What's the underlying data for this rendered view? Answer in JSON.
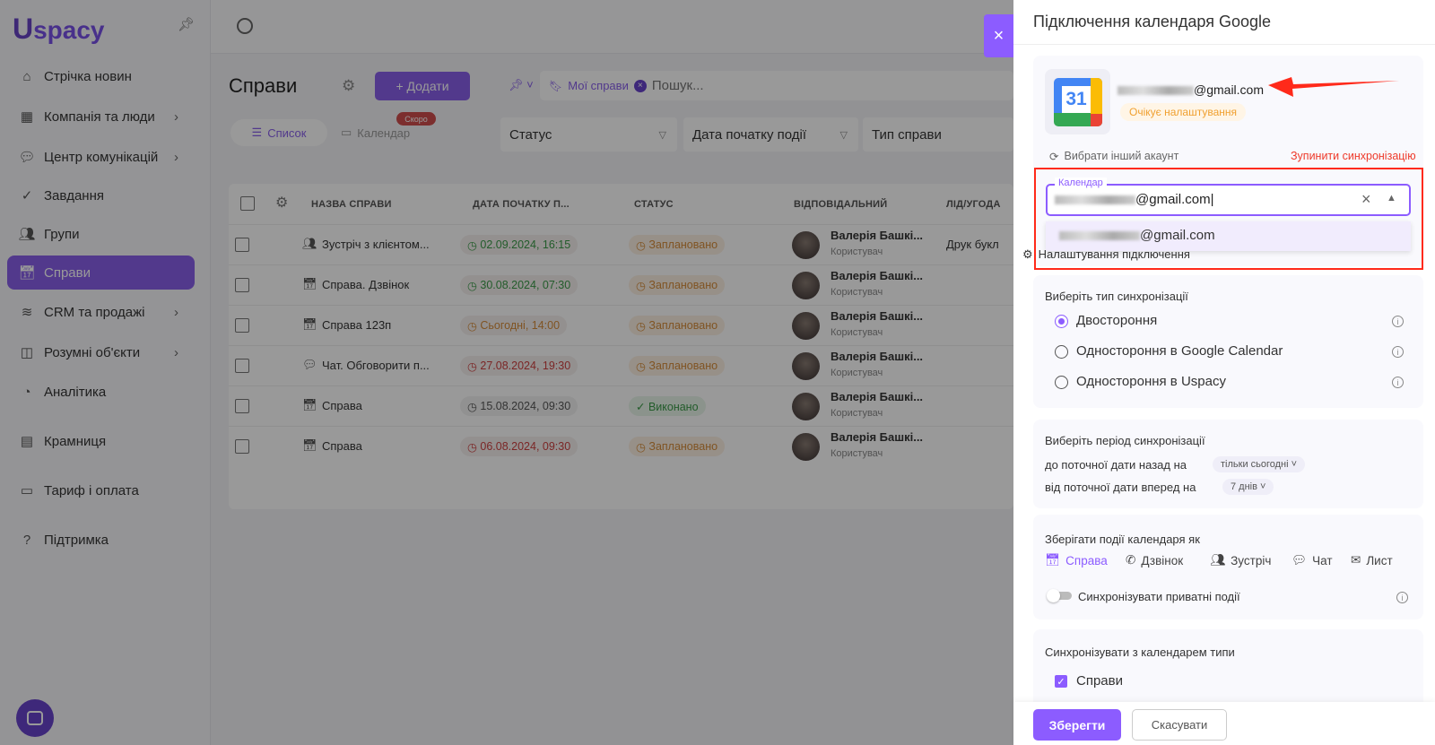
{
  "app": {
    "logo": "Uspacy"
  },
  "sidebar": {
    "items": [
      {
        "label": "Стрічка новин",
        "icon": "home-icon",
        "chevron": false
      },
      {
        "label": "Компанія та люди",
        "icon": "building-icon",
        "chevron": true
      },
      {
        "label": "Центр комунікацій",
        "icon": "chat-icon",
        "chevron": true
      },
      {
        "label": "Завдання",
        "icon": "check-circle-icon",
        "chevron": false
      },
      {
        "label": "Групи",
        "icon": "users-icon",
        "chevron": false
      },
      {
        "label": "Справи",
        "icon": "calendar-check-icon",
        "chevron": false,
        "active": true
      },
      {
        "label": "CRM та продажі",
        "icon": "database-icon",
        "chevron": true
      },
      {
        "label": "Розумні об'єкти",
        "icon": "smart-object-icon",
        "chevron": true
      },
      {
        "label": "Аналітика",
        "icon": "chart-icon",
        "chevron": false
      },
      {
        "label": "Крамниця",
        "icon": "store-icon",
        "chevron": false
      },
      {
        "label": "Тариф і оплата",
        "icon": "wallet-icon",
        "chevron": false
      },
      {
        "label": "Підтримка",
        "icon": "help-icon",
        "chevron": false
      }
    ]
  },
  "page": {
    "title": "Справи",
    "add_label": "+ Додати",
    "filter_chip": "Мої справи",
    "search_placeholder": "Пошук...",
    "tabs": [
      {
        "label": "Список",
        "active": true
      },
      {
        "label": "Календар",
        "badge": "Скоро"
      }
    ],
    "filters": [
      "Статус",
      "Дата початку події",
      "Тип справи"
    ]
  },
  "table": {
    "columns": [
      "НАЗВА СПРАВИ",
      "ДАТА ПОЧАТКУ П...",
      "СТАТУС",
      "ВІДПОВІДАЛЬНИЙ",
      "ЛІД/УГОДА"
    ],
    "rows": [
      {
        "icon": "users-icon",
        "name": "Зустріч з клієнтом...",
        "date": "02.09.2024, 16:15",
        "date_color": "#2e9e3e",
        "status": "Заплановано",
        "status_color": "#e08a2a",
        "resp": "Валерія Башкі...",
        "role": "Користувач",
        "lead": "Друк букл"
      },
      {
        "icon": "calendar-check-icon",
        "name": "Справа. Дзвінок",
        "date": "30.08.2024, 07:30",
        "date_color": "#2e9e3e",
        "status": "Заплановано",
        "status_color": "#e08a2a",
        "resp": "Валерія Башкі...",
        "role": "Користувач",
        "lead": ""
      },
      {
        "icon": "calendar-check-icon",
        "name": "Справа 123п",
        "date": "Сьогодні, 14:00",
        "date_color": "#e08a2a",
        "status": "Заплановано",
        "status_color": "#e08a2a",
        "resp": "Валерія Башкі...",
        "role": "Користувач",
        "lead": ""
      },
      {
        "icon": "chat-icon",
        "name": "Чат. Обговорити п...",
        "date": "27.08.2024, 19:30",
        "date_color": "#e03a3a",
        "status": "Заплановано",
        "status_color": "#e08a2a",
        "resp": "Валерія Башкі...",
        "role": "Користувач",
        "lead": ""
      },
      {
        "icon": "calendar-check-icon",
        "name": "Справа",
        "date": "15.08.2024, 09:30",
        "date_color": "#555555",
        "status": "✓ Виконано",
        "status_color": "#2e9e3e",
        "resp": "Валерія Башкі...",
        "role": "Користувач",
        "lead": ""
      },
      {
        "icon": "calendar-check-icon",
        "name": "Справа",
        "date": "06.08.2024, 09:30",
        "date_color": "#e03a3a",
        "status": "Заплановано",
        "status_color": "#e08a2a",
        "resp": "Валерія Башкі...",
        "role": "Користувач",
        "lead": ""
      }
    ]
  },
  "panel": {
    "title": "Підключення календаря Google",
    "close": "×",
    "account_email": "@gmail.com",
    "account_status": "Очікує налаштування",
    "change_account": "Вибрати інший акаунт",
    "stop_sync": "Зупинити синхронізацію",
    "calendar_label": "Календар",
    "calendar_value": "@gmail.com",
    "calendar_option": "@gmail.com",
    "connection_settings": "Налаштування підключення",
    "sync_type": {
      "label": "Виберіть тип синхронізації",
      "options": [
        {
          "label": "Двостороння",
          "selected": true
        },
        {
          "label": "Одностороння в Google Calendar",
          "selected": false
        },
        {
          "label": "Одностороння в Uspacy",
          "selected": false
        }
      ]
    },
    "period": {
      "label": "Виберіть період синхронізації",
      "back_label": "до поточної дати назад на",
      "back_value": "тільки сьогодні",
      "fwd_label": "від поточної дати вперед на",
      "fwd_value": "7 днів"
    },
    "save_as": {
      "label": "Зберігати події календаря як",
      "types": [
        {
          "label": "Справа",
          "icon": "calendar-check-icon",
          "selected": true
        },
        {
          "label": "Дзвінок",
          "icon": "phone-icon"
        },
        {
          "label": "Зустріч",
          "icon": "users-icon"
        },
        {
          "label": "Чат",
          "icon": "chat-icon"
        },
        {
          "label": "Лист",
          "icon": "mail-icon"
        }
      ],
      "private_label": "Синхронізувати приватні події",
      "private_on": false
    },
    "sync_types": {
      "label": "Синхронізувати з календарем типи",
      "items": [
        {
          "label": "Справи",
          "checked": true
        }
      ]
    },
    "save": "Зберегти",
    "cancel": "Скасувати"
  },
  "colors": {
    "accent": "#8c5cff",
    "annotation": "#ff2a1a",
    "pending": "#f0a030"
  }
}
